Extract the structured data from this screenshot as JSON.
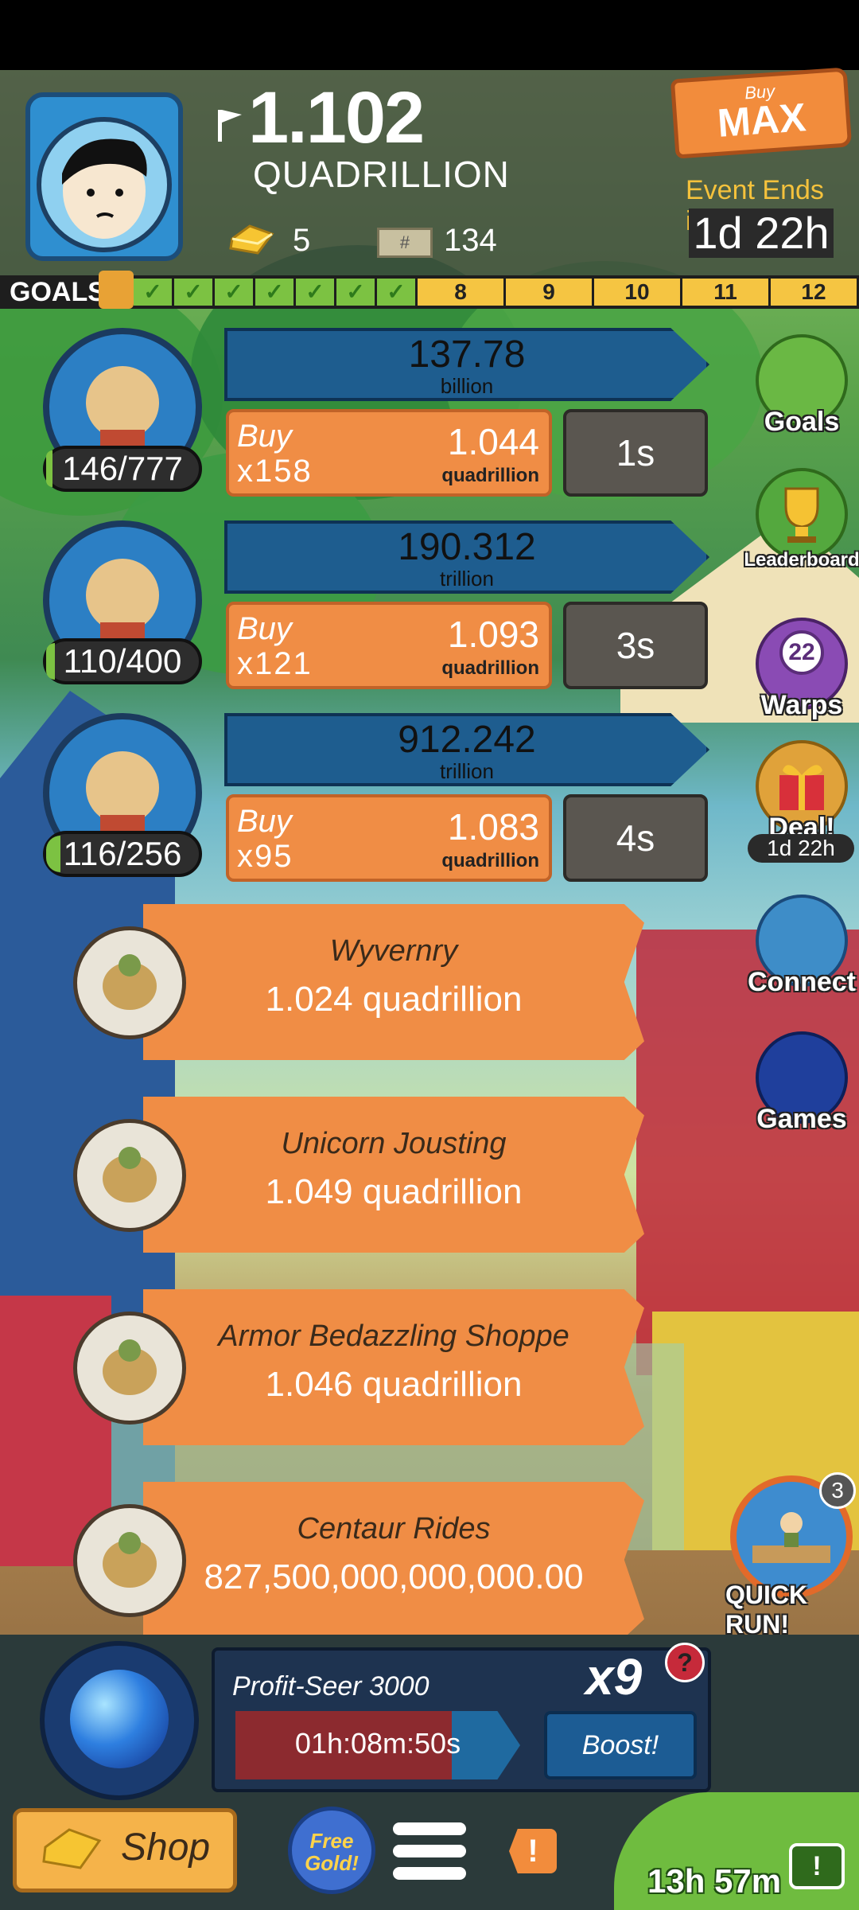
{
  "header": {
    "cash_amount": "1.102",
    "cash_unit": "QUADRILLION",
    "gold_count": "5",
    "bills_count": "134",
    "buy_max_small": "Buy",
    "buy_max_big": "MAX",
    "event_label": "Event Ends in:",
    "event_time": "1d 22h"
  },
  "goals": {
    "label": "GOALS",
    "completed_count": 7,
    "remaining": [
      "8",
      "9",
      "10",
      "11",
      "12"
    ]
  },
  "businesses": [
    {
      "owned": "146/777",
      "progress": 0.19,
      "revenue": "137.78",
      "revenue_unit": "billion",
      "buy_label": "Buy",
      "buy_qty": "x158",
      "cost": "1.044",
      "cost_unit": "quadrillion",
      "timer": "1s"
    },
    {
      "owned": "110/400",
      "progress": 0.28,
      "revenue": "190.312",
      "revenue_unit": "trillion",
      "buy_label": "Buy",
      "buy_qty": "x121",
      "cost": "1.093",
      "cost_unit": "quadrillion",
      "timer": "3s"
    },
    {
      "owned": "116/256",
      "progress": 0.45,
      "revenue": "912.242",
      "revenue_unit": "trillion",
      "buy_label": "Buy",
      "buy_qty": "x95",
      "cost": "1.083",
      "cost_unit": "quadrillion",
      "timer": "4s"
    }
  ],
  "locked_businesses": [
    {
      "name": "Wyvernry",
      "price": "1.024 quadrillion",
      "icon": "wyvern-icon"
    },
    {
      "name": "Unicorn Jousting",
      "price": "1.049 quadrillion",
      "icon": "unicorn-icon"
    },
    {
      "name": "Armor Bedazzling Shoppe",
      "price": "1.046 quadrillion",
      "icon": "armor-icon"
    },
    {
      "name": "Centaur Rides",
      "price": "827,500,000,000,000.00",
      "icon": "centaur-icon"
    }
  ],
  "side_menu": {
    "goals": "Goals",
    "leaderboard": "Leaderboard",
    "warps": "Warps",
    "warps_count": "22",
    "deal": "Deal!",
    "deal_time": "1d 22h",
    "connect": "Connect",
    "games": "Games"
  },
  "quick_run": {
    "label": "QUICK RUN!",
    "badge": "3"
  },
  "profit_seer": {
    "name": "Profit-Seer 3000",
    "multiplier": "x9",
    "help": "?",
    "timer": "01h:08m:50s",
    "fill": 0.76,
    "boost_label": "Boost!"
  },
  "bottom_bar": {
    "shop_label": "Shop",
    "free_gold": "Free Gold!",
    "alert": "!",
    "tv_time": "13h 57m",
    "tv_badge": "!"
  },
  "colors": {
    "orange": "#f08d45",
    "blue": "#1e5d8f",
    "progress_green": "#7cc242",
    "goal_yellow": "#f5c542"
  }
}
